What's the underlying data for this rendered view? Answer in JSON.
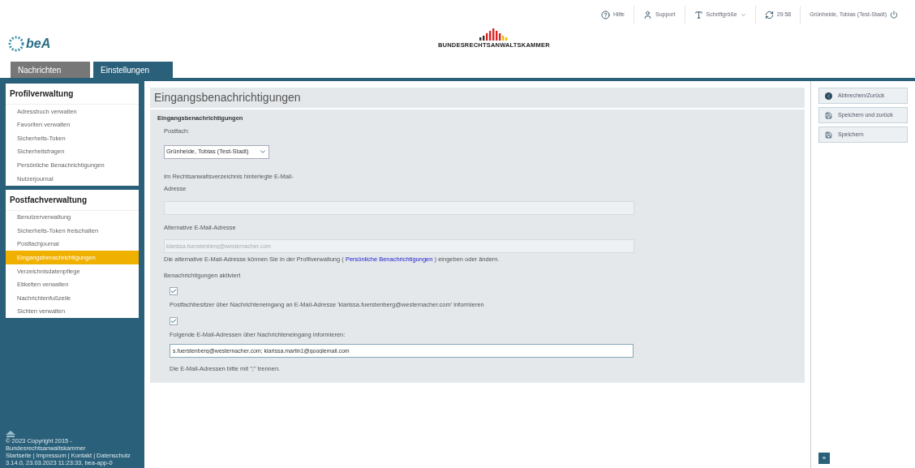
{
  "topbar": [
    {
      "kind": "help",
      "label": "Hilfe"
    },
    {
      "kind": "user",
      "label": "Support"
    },
    {
      "kind": "font",
      "label": "Schriftgröße"
    },
    {
      "kind": "refresh",
      "label": "29:58"
    },
    {
      "kind": "logout",
      "label": "Grünheide, Tobias (Test-Stadt)"
    }
  ],
  "logo": {
    "text": "beA"
  },
  "brand": {
    "text": "BUNDESRECHTSANWALTSKAMMER"
  },
  "tabs": [
    {
      "label": "Nachrichten",
      "selected": false
    },
    {
      "label": "Einstellungen",
      "selected": true
    }
  ],
  "sidebar": [
    {
      "title": "Profilverwaltung",
      "items": [
        {
          "label": "Adressbuch verwalten",
          "selected": false
        },
        {
          "label": "Favoriten verwalten",
          "selected": false
        },
        {
          "label": "Sicherheits-Token",
          "selected": false
        },
        {
          "label": "Sicherheitsfragen",
          "selected": false
        },
        {
          "label": "Persönliche Benachrichtigungen",
          "selected": false
        },
        {
          "label": "Nutzerjournal",
          "selected": false
        }
      ]
    },
    {
      "title": "Postfachverwaltung",
      "items": [
        {
          "label": "Benutzerverwaltung",
          "selected": false
        },
        {
          "label": "Sicherheits-Token freischalten",
          "selected": false
        },
        {
          "label": "Postfachjournal",
          "selected": false
        },
        {
          "label": "Eingangsbenachrichtigungen",
          "selected": true
        },
        {
          "label": "Verzeichnisdatenpflege",
          "selected": false
        },
        {
          "label": "Etiketten verwalten",
          "selected": false
        },
        {
          "label": "Nachrichtenfußzeile",
          "selected": false
        },
        {
          "label": "Sichten verwalten",
          "selected": false
        }
      ]
    }
  ],
  "footer": {
    "copyright": "© 2023 Copyright 2015 - Bundesrechtsanwaltskammer",
    "links": [
      "Startseite",
      "Impressum",
      "Kontakt",
      "Datenschutz"
    ],
    "separator": "|",
    "version": "3.14.0, 23.03.2023 11:23:33, bea-app-0"
  },
  "page": {
    "title": "Eingangsbenachrichtigungen",
    "section": "Eingangsbenachrichtigungen",
    "postfach_label": "Postfach:",
    "postfach_value": "Grünheide, Tobias (Test-Stadt)",
    "rav_label": "Im Rechtsanwaltsverzeichnis hinterlegte E-Mail-Adresse",
    "alt_label": "Alternative E-Mail-Adresse",
    "alt_placeholder": "klarissa.fuerstenberg@westernacher.com",
    "hint_before": "Die alternative E-Mail-Adresse können Sie in der Profilverwaltung (",
    "hint_link": "Persönliche Benachrichtigungen",
    "hint_after": ") eingeben oder ändern.",
    "activated_label": "Benachrichtigungen aktiviert",
    "options": [
      {
        "label": "Postfachbesitzer über Nachrichteneingang an E-Mail-Adresse 'klarissa.fuerstenberg@westernacher.com' informieren",
        "checked": true
      },
      {
        "label": "Folgende E-Mail-Adressen über Nachrichteneingang informieren:",
        "checked": true
      }
    ],
    "emails_value": "s.fuerstenberg@westernacher.com; klarissa.martin1@googlemail.com",
    "emails_hint": "Die E-Mail-Adressen bitte mit \";\" trennen."
  },
  "actions": [
    {
      "kind": "back",
      "label": "Abbrechen/Zurück"
    },
    {
      "kind": "save",
      "label": "Speichern und zurück"
    },
    {
      "kind": "save",
      "label": "Speichern"
    }
  ],
  "expand": {
    "label": "»"
  }
}
